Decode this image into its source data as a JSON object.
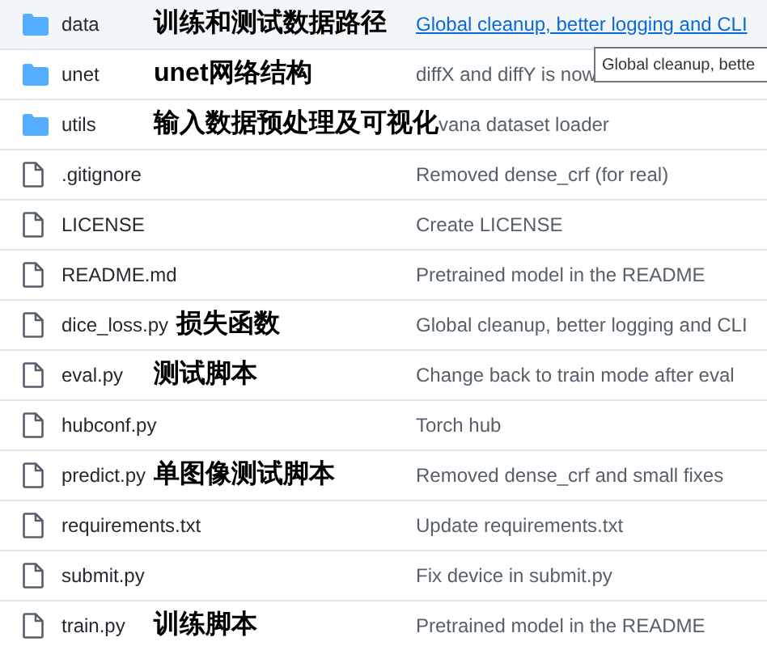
{
  "files": [
    {
      "kind": "folder",
      "name": "data",
      "note": "训练和测试数据路径",
      "message": "Global cleanup, better logging and CLI",
      "selected": true
    },
    {
      "kind": "folder",
      "name": "unet",
      "note": "unet网络结构",
      "message": "diffX and diffY is now",
      "selected": false
    },
    {
      "kind": "folder",
      "name": "utils",
      "note": "输入数据预处理及可视化",
      "message": "vana dataset loader",
      "selected": false
    },
    {
      "kind": "file",
      "name": ".gitignore",
      "message": "Removed dense_crf (for real)",
      "selected": false
    },
    {
      "kind": "file",
      "name": "LICENSE",
      "message": "Create LICENSE",
      "selected": false
    },
    {
      "kind": "file",
      "name": "README.md",
      "message": "Pretrained model in the README",
      "selected": false
    },
    {
      "kind": "file",
      "name": "dice_loss.py",
      "note": "损失函数",
      "message": "Global cleanup, better logging and CLI",
      "selected": false
    },
    {
      "kind": "file",
      "name": "eval.py",
      "note": "测试脚本",
      "message": "Change back to train mode after eval",
      "selected": false
    },
    {
      "kind": "file",
      "name": "hubconf.py",
      "message": "Torch hub",
      "selected": false
    },
    {
      "kind": "file",
      "name": "predict.py",
      "note": "单图像测试脚本",
      "message": "Removed dense_crf and small fixes",
      "selected": false
    },
    {
      "kind": "file",
      "name": "requirements.txt",
      "message": "Update requirements.txt",
      "selected": false
    },
    {
      "kind": "file",
      "name": "submit.py",
      "message": "Fix device in submit.py",
      "selected": false
    },
    {
      "kind": "file",
      "name": "train.py",
      "note": "训练脚本",
      "message": "Pretrained model in the README",
      "selected": false
    }
  ],
  "tooltip": {
    "text": "Global cleanup, bette"
  }
}
